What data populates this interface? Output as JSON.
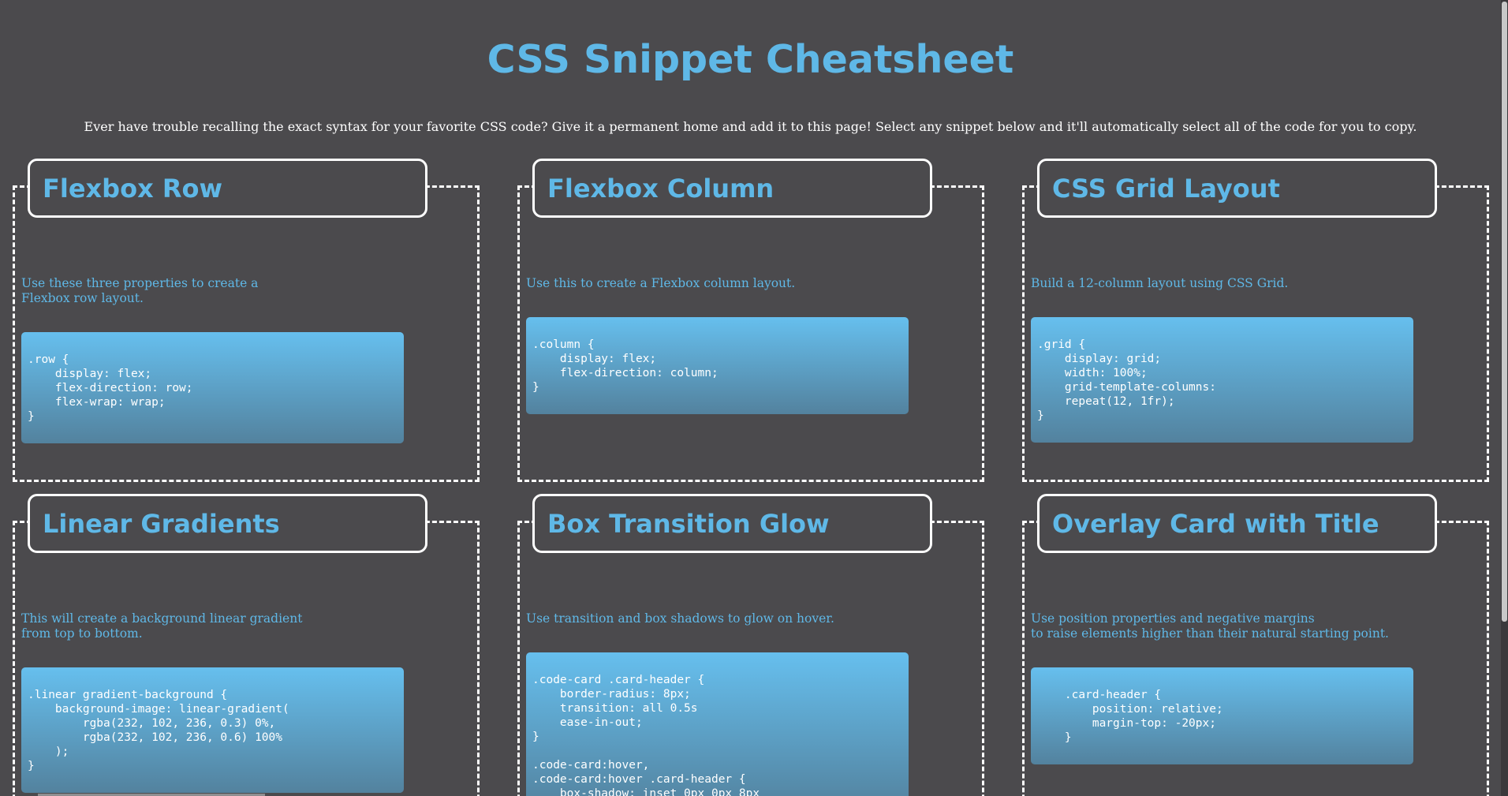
{
  "page": {
    "title": "CSS Snippet Cheatsheet",
    "subtitle": "Ever have trouble recalling the exact syntax for your favorite CSS code? Give it a permanent home and add it to this page! Select any snippet below and it'll automatically select all of the code for you to copy."
  },
  "colors": {
    "background": "#4b4a4d",
    "accent": "#5fb8e7",
    "code_gradient_top": "#66bfee",
    "code_gradient_bottom": "#53829e",
    "border": "#ffffff"
  },
  "cards": [
    {
      "title": "Flexbox Row",
      "description": "Use these three properties to create a\nFlexbox row layout.",
      "code": ".row {\n    display: flex;\n    flex-direction: row;\n    flex-wrap: wrap;\n}"
    },
    {
      "title": "Flexbox Column",
      "description": "Use this to create a Flexbox column layout.",
      "code": ".column {\n    display: flex;\n    flex-direction: column;\n}"
    },
    {
      "title": "CSS Grid Layout",
      "description": "Build a 12-column layout using CSS Grid.",
      "code": ".grid {\n    display: grid;\n    width: 100%;\n    grid-template-columns:\n    repeat(12, 1fr);\n}"
    },
    {
      "title": "Linear Gradients",
      "description": "This will create a background linear gradient\nfrom top to bottom.",
      "code": ".linear gradient-background {\n    background-image: linear-gradient(\n        rgba(232, 102, 236, 0.3) 0%,\n        rgba(232, 102, 236, 0.6) 100%\n    );\n}"
    },
    {
      "title": "Box Transition Glow",
      "description": "Use transition and box shadows to glow on hover.",
      "code": ".code-card .card-header {\n    border-radius: 8px;\n    transition: all 0.5s\n    ease-in-out;\n}\n\n.code-card:hover,\n.code-card:hover .card-header {\n    box-shadow: inset 0px 0px 8px"
    },
    {
      "title": "Overlay Card with Title",
      "description": "Use position properties and negative margins\nto raise elements higher than their natural starting point.",
      "code": "    .card-header {\n        position: relative;\n        margin-top: -20px;\n    }"
    }
  ]
}
